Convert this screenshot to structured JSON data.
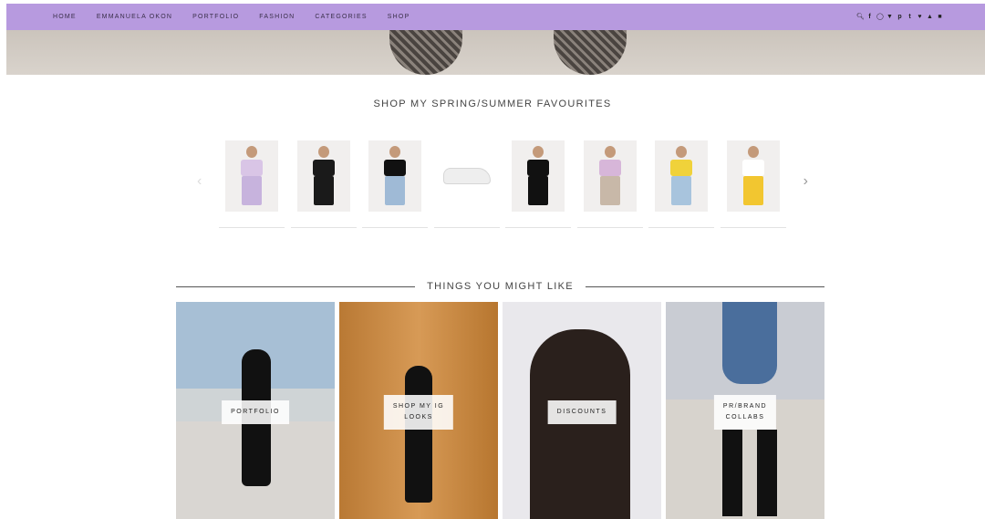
{
  "nav": {
    "items": [
      "HOME",
      "EMMANUELA OKON",
      "PORTFOLIO",
      "FASHION",
      "CATEGORIES",
      "SHOP"
    ],
    "social_icons": [
      "search-icon",
      "facebook-icon",
      "instagram-icon",
      "twitter-icon",
      "pinterest-icon",
      "tumblr-icon",
      "heart-icon",
      "snapchat-icon",
      "youtube-icon"
    ]
  },
  "shop": {
    "title": "SHOP MY SPRING/SUMMER FAVOURITES",
    "prev_arrow": "‹",
    "next_arrow": "›",
    "products": [
      {
        "name": "lilac-crop-top-set",
        "top": "#d9c5e6",
        "bottom": "#c7b3dd"
      },
      {
        "name": "black-crop-leggings",
        "top": "#1a1a1a",
        "bottom": "#1a1a1a"
      },
      {
        "name": "black-top-denim-skirt",
        "top": "#111111",
        "bottom": "#9fbad6"
      },
      {
        "name": "white-sneakers",
        "top": "#efefef",
        "bottom": "#efefef"
      },
      {
        "name": "black-halter-dress",
        "top": "#111111",
        "bottom": "#111111"
      },
      {
        "name": "lilac-tank-top",
        "top": "#d7b6d9",
        "bottom": "#c8b8a8"
      },
      {
        "name": "yellow-crop-top",
        "top": "#f0d23a",
        "bottom": "#a8c4dd"
      },
      {
        "name": "yellow-skirt-set",
        "top": "#ffffff",
        "bottom": "#f2c630"
      }
    ]
  },
  "things": {
    "title": "THINGS YOU MIGHT LIKE",
    "tiles": [
      {
        "label": "PORTFOLIO"
      },
      {
        "label": "SHOP MY IG\nLOOKS"
      },
      {
        "label": "DISCOUNTS"
      },
      {
        "label": "PR/BRAND\nCOLLABS"
      }
    ]
  },
  "colors": {
    "nav_bg": "#b79adf",
    "accent": "#b79adf"
  }
}
